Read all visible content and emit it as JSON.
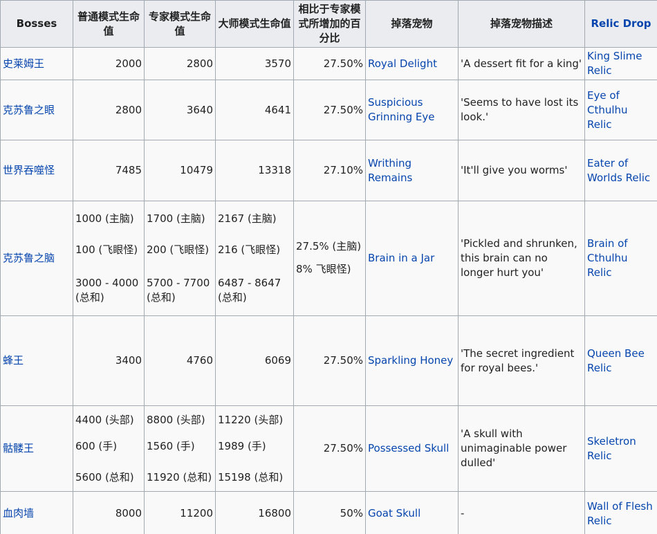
{
  "headers": {
    "bosses": "Bosses",
    "normal_hp": "普通模式生命值",
    "expert_hp": "专家模式生命值",
    "master_hp": "大师模式生命值",
    "increase_pct": "相比于专家模式所增加的百分比",
    "pet_drop": "掉落宠物",
    "pet_desc": "掉落宠物描述",
    "relic_drop": "Relic Drop"
  },
  "rows": [
    {
      "boss": "史莱姆王",
      "normal": "2000",
      "expert": "2800",
      "master": "3570",
      "increase": "27.50%",
      "pet": "Royal Delight",
      "desc": "'A dessert fit for a king'",
      "relic": "King Slime Relic"
    },
    {
      "boss": "克苏鲁之眼",
      "normal": "2800",
      "expert": "3640",
      "master": "4641",
      "increase": "27.50%",
      "pet": "Suspicious Grinning Eye",
      "desc": "'Seems to have lost its look.'",
      "relic": "Eye of Cthulhu Relic"
    },
    {
      "boss": "世界吞噬怪",
      "normal": "7485",
      "expert": "10479",
      "master": "13318",
      "increase": "27.10%",
      "pet": "Writhing Remains",
      "desc": "'It'll give you worms'",
      "relic": "Eater of Worlds Relic"
    },
    {
      "boss": "克苏鲁之脑",
      "normal": [
        "1000 (主脑)",
        "100 (飞眼怪)",
        "3000 - 4000 (总和)"
      ],
      "expert": [
        "1700 (主脑)",
        "200 (飞眼怪)",
        "5700 - 7700 (总和)"
      ],
      "master": [
        "2167 (主脑)",
        "216 (飞眼怪)",
        "6487 - 8647 (总和)"
      ],
      "increase": [
        "27.5% (主脑)",
        "8% 飞眼怪)"
      ],
      "pet": "Brain in a Jar",
      "desc": "'Pickled and shrunken, this brain can no longer hurt you'",
      "relic": "Brain of Cthulhu Relic"
    },
    {
      "boss": "蜂王",
      "normal": "3400",
      "expert": "4760",
      "master": "6069",
      "increase": "27.50%",
      "pet": "Sparkling Honey",
      "desc": "'The secret ingredient for royal bees.'",
      "relic": "Queen Bee Relic"
    },
    {
      "boss": "骷髅王",
      "normal": [
        "4400 (头部)",
        "600 (手)",
        "5600 (总和)"
      ],
      "expert": [
        "8800 (头部)",
        "1560 (手)",
        "11920 (总和)"
      ],
      "master": [
        "11220 (头部)",
        "1989 (手)",
        "15198 (总和)"
      ],
      "increase": "27.50%",
      "pet": "Possessed Skull",
      "desc": "'A skull with unimaginable power dulled'",
      "relic": "Skeletron Relic"
    },
    {
      "boss": "血肉墙",
      "normal": "8000",
      "expert": "11200",
      "master": "16800",
      "increase": "50%",
      "pet": "Goat Skull",
      "desc": "-",
      "relic": "Wall of Flesh Relic"
    }
  ]
}
